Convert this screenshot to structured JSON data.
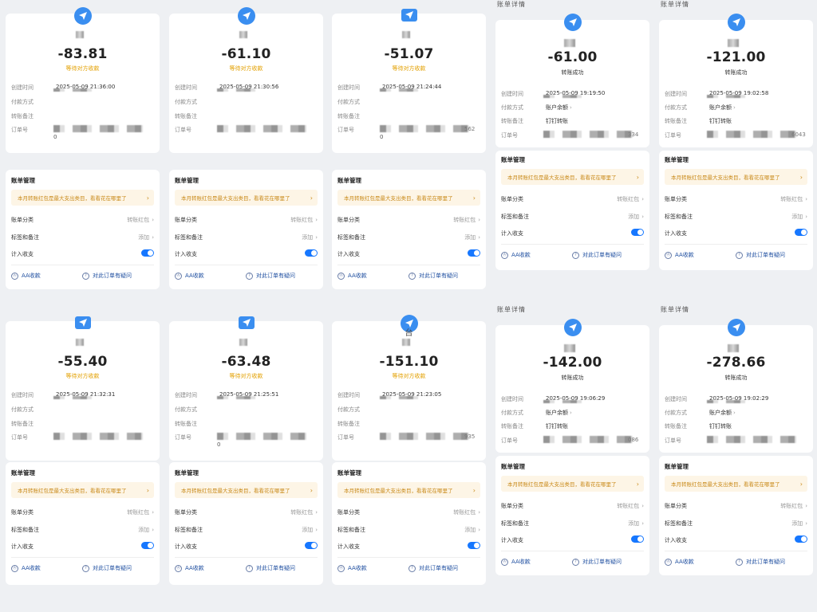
{
  "labels": {
    "created": "创建时间",
    "payment": "付款方式",
    "remark": "转账备注",
    "order": "订单号",
    "mgmt_title": "账单管理",
    "banner": "本月转账红包是最大支出类目，看看花在哪里了",
    "category": "账单分类",
    "category_value": "转账红包",
    "tags": "标签和备注",
    "tags_value": "添加",
    "income": "计入收支",
    "aa": "AA收款",
    "question": "对此订单有疑问"
  },
  "colors": {
    "accent": "#1677ff",
    "pending": "#e3a000",
    "banner_bg": "#fdf5e6",
    "banner_text": "#c98a1a"
  },
  "icons": {
    "chevron": "›",
    "aa": "Ⓐ",
    "question": "?"
  },
  "screens": [
    {
      "amount": "-83.81",
      "status": "等待对方收款",
      "created_time": "2025-05-09 21:36:00",
      "order_tail": "0",
      "order_extra": ""
    },
    {
      "amount": "-61.10",
      "status": "等待对方收款",
      "created_time": "2025-05-09 21:30:56",
      "order_tail": "",
      "order_extra": ""
    },
    {
      "amount": "-51.07",
      "status": "等待对方收款",
      "created_time": "2025-05-09 21:24:44",
      "order_tail": "0",
      "order_extra": "562"
    },
    {
      "amount": "-61.00",
      "status": "转账成功",
      "created_time": "2025-05-09 19:19:50",
      "payment_value": "账户余额",
      "remark_value": "钉钉转账",
      "order_extra": "334",
      "header": "账单详情"
    },
    {
      "amount": "-121.00",
      "status": "转账成功",
      "created_time": "2025-05-09 19:02:58",
      "payment_value": "账户余额",
      "remark_value": "钉钉转账",
      "order_extra": "6043",
      "header": "账单详情"
    },
    {
      "amount": "-55.40",
      "status": "等待对方收款",
      "created_time": "2025-05-09 21:32:31",
      "order_tail": "",
      "order_extra": ""
    },
    {
      "amount": "-63.48",
      "status": "等待对方收款",
      "created_time": "2025-05-09 21:25:51",
      "order_tail": "0",
      "order_extra": ""
    },
    {
      "amount": "-151.10",
      "status": "等待对方收款",
      "created_time": "2025-05-09 21:23:05",
      "order_tail": "",
      "order_extra": "935",
      "sender_name": "台"
    },
    {
      "amount": "-142.00",
      "status": "转账成功",
      "created_time": "2025-05-09 19:06:29",
      "payment_value": "账户余额",
      "remark_value": "钉钉转账",
      "order_extra": "086",
      "header": "账单详情"
    },
    {
      "amount": "-278.66",
      "status": "转账成功",
      "created_time": "2025-05-09 19:02:29",
      "payment_value": "账户余额",
      "remark_value": "钉钉转账",
      "order_extra": "",
      "header": "账单详情"
    }
  ]
}
